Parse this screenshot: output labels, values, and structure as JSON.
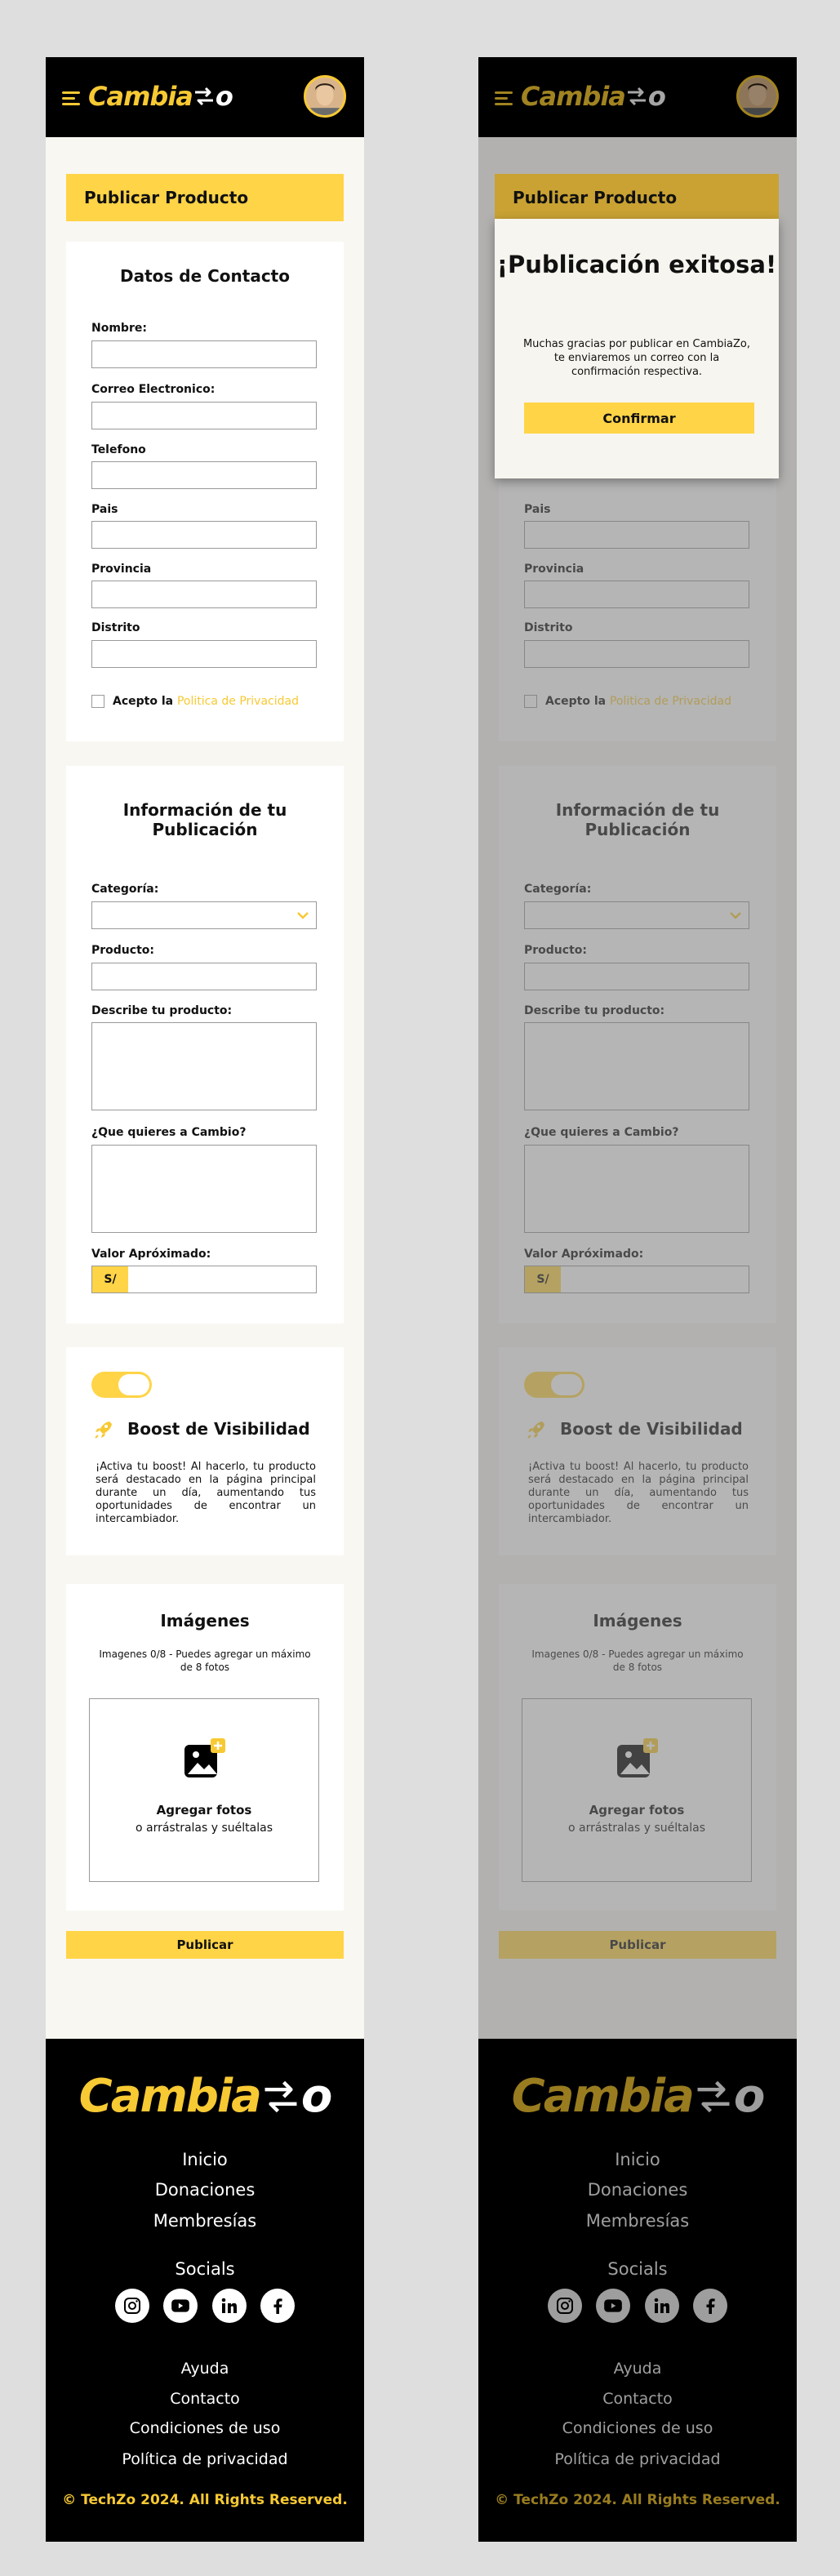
{
  "header": {
    "logo_main": "Cambia",
    "logo_end": "o"
  },
  "page_title": "Publicar Producto",
  "contact": {
    "heading": "Datos de Contacto",
    "fields": [
      "Nombre:",
      "Correo Electronico:",
      "Telefono",
      "Pais",
      "Provincia",
      "Distrito"
    ],
    "accept_prefix": "Acepto la",
    "accept_link": "Politica de Privacidad"
  },
  "publication": {
    "heading": "Información de tu Publicación",
    "category_label": "Categoría:",
    "product_label": "Producto:",
    "describe_label": "Describe tu producto:",
    "want_label": "¿Que quieres a Cambio?",
    "value_label": "Valor Apróximado:",
    "currency": "S/"
  },
  "boost": {
    "title": "Boost de Visibilidad",
    "text": "¡Activa tu boost! Al hacerlo, tu producto será destacado en la página principal durante un día, aumentando tus oportunidades de encontrar un intercambiador.",
    "enabled": true
  },
  "images": {
    "heading": "Imágenes",
    "subtitle": "Imagenes 0/8 - Puedes agregar un máximo de 8 fotos",
    "add_title": "Agregar fotos",
    "add_sub": "o arrástralas y suéltalas"
  },
  "publish_button": "Publicar",
  "footer": {
    "logo_main": "Cambia",
    "logo_end": "o",
    "nav": [
      "Inicio",
      "Donaciones",
      "Membresías"
    ],
    "socials_title": "Socials",
    "social_icons": [
      "instagram-icon",
      "youtube-icon",
      "linkedin-icon",
      "facebook-icon"
    ],
    "links": [
      "Ayuda",
      "Contacto",
      "Condiciones de uso",
      "Política de privacidad"
    ],
    "copyright": "© TechZo 2024. All Rights Reserved."
  },
  "modal": {
    "title": "¡Publicación exitosa!",
    "message": "Muchas gracias por publicar en CambiaZo, te enviaremos un correo con la confirmación respectiva.",
    "confirm": "Confirmar"
  },
  "colors": {
    "accent": "#ffd447",
    "brand_yellow": "#f7c933",
    "dark": "#000000",
    "background": "#f9f7f2"
  }
}
